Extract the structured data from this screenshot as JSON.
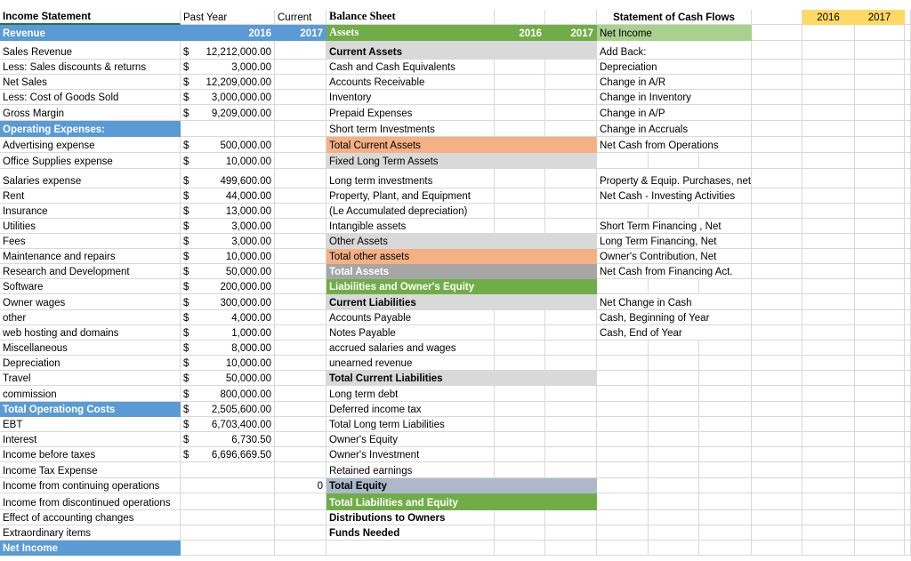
{
  "colors": {
    "header_blue": "#5b9bd5",
    "assets_green": "#70ad47",
    "net_income_green": "#a9d18e",
    "section_grey": "#d9d9d9",
    "total_orange": "#f4b183",
    "total_assets_grey": "#a6a6a6",
    "total_equity": "#acb9ca",
    "year_yellow": "#ffd966"
  },
  "rows": [
    {
      "income": {
        "label": "Income Statement",
        "style": "bold sel",
        "past": "Past Year",
        "current": "Current",
        "hdr": "text"
      },
      "balance": {
        "label": "Balance Sheet",
        "style": "serif"
      },
      "cashflow": {
        "label": "Statement of Cash Flows",
        "style": "bold c",
        "y2016": "2016",
        "y2017": "2017"
      }
    },
    {
      "income": {
        "label": "Revenue",
        "style": "blue",
        "past": "2016",
        "current": "2017",
        "hdr": "year"
      },
      "balance": {
        "label": "Assets",
        "style": "green serif",
        "y2016": "2016",
        "y2017": "2017"
      },
      "cashflow": {
        "label": "Net Income",
        "style": "lgreen"
      }
    },
    {
      "income": {
        "label": "Sales Revenue",
        "currency": "$",
        "past": "12,212,000.00"
      },
      "balance": {
        "label": "Current Assets",
        "style": "greyb"
      },
      "cashflow": {
        "label": "Add Back:"
      }
    },
    {
      "income": {
        "label": "Less: Sales discounts & returns",
        "currency": "$",
        "past": "3,000.00"
      },
      "balance": {
        "label": "Cash and Cash Equivalents"
      },
      "cashflow": {
        "label": "Depreciation"
      }
    },
    {
      "income": {
        "label": "Net Sales",
        "currency": "$",
        "past": "12,209,000.00"
      },
      "balance": {
        "label": "Accounts Receivable"
      },
      "cashflow": {
        "label": "Change in A/R"
      }
    },
    {
      "income": {
        "label": "Less: Cost of Goods Sold",
        "currency": "$",
        "past": "3,000,000.00"
      },
      "balance": {
        "label": "Inventory"
      },
      "cashflow": {
        "label": "Change in Inventory"
      }
    },
    {
      "income": {
        "label": "Gross Margin",
        "currency": "$",
        "past": "9,209,000.00"
      },
      "balance": {
        "label": "Prepaid Expenses"
      },
      "cashflow": {
        "label": "Change in A/P"
      }
    },
    {
      "income": {
        "label": "Operating Expenses:",
        "style": "blue"
      },
      "balance": {
        "label": "Short term Investments"
      },
      "cashflow": {
        "label": "Change in Accruals"
      }
    },
    {
      "income": {
        "label": "Advertising expense",
        "currency": "$",
        "past": "500,000.00"
      },
      "balance": {
        "label": "Total Current Assets",
        "style": "orange"
      },
      "cashflow": {
        "label": "Net Cash from Operations"
      }
    },
    {
      "income": {
        "label": "Office Supplies expense",
        "currency": "$",
        "past": "10,000.00"
      },
      "balance": {
        "label": "Fixed Long Term Assets",
        "style": "grey"
      },
      "cashflow": {
        "label": ""
      }
    },
    {
      "income": {
        "label": "Salaries expense",
        "currency": "$",
        "past": "499,600.00"
      },
      "balance": {
        "label": "Long term investments"
      },
      "cashflow": {
        "label": "Property & Equip. Purchases, net"
      }
    },
    {
      "income": {
        "label": "Rent",
        "currency": "$",
        "past": "44,000.00"
      },
      "balance": {
        "label": "Property, Plant, and Equipment"
      },
      "cashflow": {
        "label": "Net Cash - Investing Activities"
      }
    },
    {
      "income": {
        "label": "Insurance",
        "currency": "$",
        "past": "13,000.00"
      },
      "balance": {
        "label": "(Le Accumulated depreciation)"
      },
      "cashflow": {
        "label": ""
      }
    },
    {
      "income": {
        "label": "Utilities",
        "currency": "$",
        "past": "3,000.00"
      },
      "balance": {
        "label": "Intangible assets"
      },
      "cashflow": {
        "label": "Short Term Financing , Net"
      }
    },
    {
      "income": {
        "label": "Fees",
        "currency": "$",
        "past": "3,000.00"
      },
      "balance": {
        "label": "Other Assets",
        "style": "grey"
      },
      "cashflow": {
        "label": "Long Term Financing, Net"
      }
    },
    {
      "income": {
        "label": "Maintenance and repairs",
        "currency": "$",
        "past": "10,000.00"
      },
      "balance": {
        "label": "Total other assets",
        "style": "orange"
      },
      "cashflow": {
        "label": "Owner's Contribution, Net"
      }
    },
    {
      "income": {
        "label": "Research and Development",
        "currency": "$",
        "past": "50,000.00"
      },
      "balance": {
        "label": "Total Assets",
        "style": "dgrey"
      },
      "cashflow": {
        "label": "Net Cash from Financing Act."
      }
    },
    {
      "income": {
        "label": "Software",
        "currency": "$",
        "past": "200,000.00"
      },
      "balance": {
        "label": "Liabilities and Owner's Equity",
        "style": "green"
      },
      "cashflow": {
        "label": ""
      }
    },
    {
      "income": {
        "label": "Owner wages",
        "currency": "$",
        "past": "300,000.00"
      },
      "balance": {
        "label": "Current Liabilities",
        "style": "greyb"
      },
      "cashflow": {
        "label": "Net Change in Cash"
      }
    },
    {
      "income": {
        "label": "other",
        "currency": "$",
        "past": "4,000.00"
      },
      "balance": {
        "label": "Accounts Payable"
      },
      "cashflow": {
        "label": "Cash, Beginning of Year"
      }
    },
    {
      "income": {
        "label": "web hosting and domains",
        "currency": "$",
        "past": "1,000.00"
      },
      "balance": {
        "label": "Notes Payable"
      },
      "cashflow": {
        "label": "Cash, End of Year"
      }
    },
    {
      "income": {
        "label": "Miscellaneous",
        "currency": "$",
        "past": "8,000.00"
      },
      "balance": {
        "label": "accrued salaries and wages"
      },
      "cashflow": {
        "label": ""
      }
    },
    {
      "income": {
        "label": "Depreciation",
        "currency": "$",
        "past": "10,000.00"
      },
      "balance": {
        "label": "unearned revenue"
      },
      "cashflow": {
        "label": ""
      }
    },
    {
      "income": {
        "label": "Travel",
        "currency": "$",
        "past": "50,000.00"
      },
      "balance": {
        "label": "Total Current Liabilities",
        "style": "greyb"
      },
      "cashflow": {
        "label": ""
      }
    },
    {
      "income": {
        "label": "commission",
        "currency": "$",
        "past": "800,000.00"
      },
      "balance": {
        "label": "Long term debt"
      },
      "cashflow": {
        "label": ""
      }
    },
    {
      "income": {
        "label": "Total Operationg Costs",
        "style": "blue",
        "currency": "$",
        "past": "2,505,600.00"
      },
      "balance": {
        "label": "Deferred income tax"
      },
      "cashflow": {
        "label": ""
      }
    },
    {
      "income": {
        "label": "EBT",
        "currency": "$",
        "past": "6,703,400.00"
      },
      "balance": {
        "label": "Total Long term Liabilities"
      },
      "cashflow": {
        "label": ""
      }
    },
    {
      "income": {
        "label": "Interest",
        "currency": "$",
        "past": "6,730.50"
      },
      "balance": {
        "label": "Owner's Equity"
      },
      "cashflow": {
        "label": ""
      }
    },
    {
      "income": {
        "label": "Income before taxes",
        "currency": "$",
        "past": "6,696,669.50"
      },
      "balance": {
        "label": "Owner's Investment"
      },
      "cashflow": {
        "label": ""
      }
    },
    {
      "income": {
        "label": "Income Tax Expense"
      },
      "balance": {
        "label": "Retained earnings"
      },
      "cashflow": {
        "label": ""
      }
    },
    {
      "income": {
        "label": "Income from continuing operations",
        "current": "0"
      },
      "balance": {
        "label": "Total Equity",
        "style": "slate"
      },
      "cashflow": {
        "label": ""
      }
    },
    {
      "income": {
        "label": "Income from discontinued operations"
      },
      "balance": {
        "label": "Total  Liabilities and Equity",
        "style": "green"
      },
      "cashflow": {
        "label": ""
      }
    },
    {
      "income": {
        "label": "Effect of accounting changes"
      },
      "balance": {
        "label": "Distributions to Owners",
        "style": "bold"
      },
      "cashflow": {
        "label": ""
      }
    },
    {
      "income": {
        "label": "Extraordinary items"
      },
      "balance": {
        "label": "Funds Needed",
        "style": "bold"
      },
      "cashflow": {
        "label": ""
      }
    },
    {
      "income": {
        "label": "Net Income",
        "style": "blue"
      },
      "balance": {
        "label": ""
      },
      "cashflow": {
        "label": ""
      }
    }
  ]
}
